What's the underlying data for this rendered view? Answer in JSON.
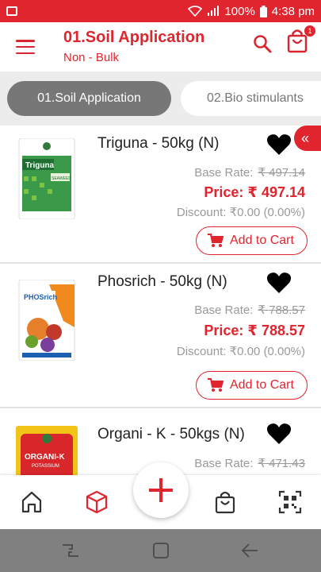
{
  "status_bar": {
    "battery": "100%",
    "time": "4:38 pm"
  },
  "header": {
    "title": "01.Soil Application",
    "subtitle": "Non - Bulk",
    "cart_count": "1"
  },
  "tabs": [
    {
      "label": "01.Soil Application",
      "active": true
    },
    {
      "label": "02.Bio stimulants",
      "active": false
    }
  ],
  "collapse_label": "«",
  "products": [
    {
      "name": "Triguna - 50kg (N)",
      "base_label": "Base Rate:",
      "base_rate": "₹ 497.14",
      "price_text": "Price: ₹ 497.14",
      "discount_text": "Discount: ₹0.00 (0.00%)",
      "cart_label": "Add to Cart",
      "image_text": "Triguna",
      "image_subtext": "SEAWEED"
    },
    {
      "name": "Phosrich - 50kg (N)",
      "base_label": "Base Rate:",
      "base_rate": "₹ 788.57",
      "price_text": "Price: ₹ 788.57",
      "discount_text": "Discount: ₹0.00 (0.00%)",
      "cart_label": "Add to Cart",
      "image_text": "PHOSrich"
    },
    {
      "name": "Organi - K - 50kgs (N)",
      "base_label": "Base Rate:",
      "base_rate": "₹ 471.43",
      "image_text": "ORGANI-K",
      "image_subtext": "POTASSIUM"
    }
  ],
  "fab_label": "+",
  "colors": {
    "accent": "#e0252f",
    "muted": "#9a9a9a",
    "tab_active": "#777777"
  }
}
